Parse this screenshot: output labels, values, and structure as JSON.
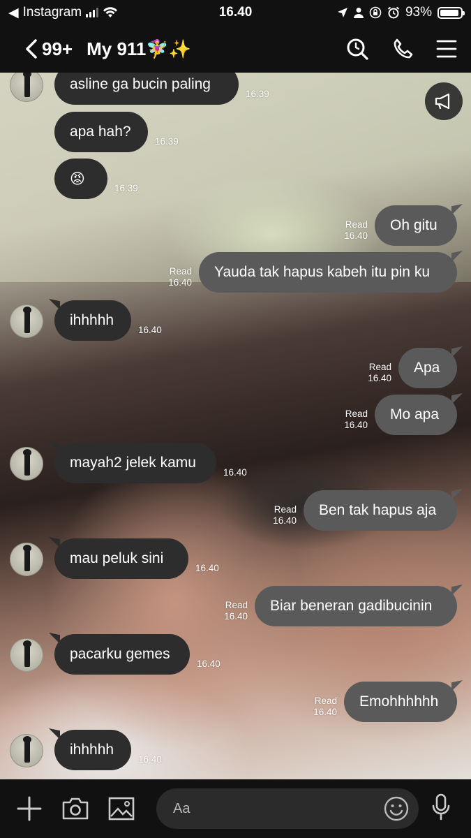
{
  "status_bar": {
    "back_app": "Instagram",
    "time": "16.40",
    "battery": "93%",
    "battery_level": 0.93
  },
  "header": {
    "back_count": "99+",
    "title": "My 911🧚‍♀️✨"
  },
  "input": {
    "placeholder": "Aa"
  },
  "messages": [
    {
      "side": "in",
      "text": "asline ga bucin paling",
      "time": "16.39"
    },
    {
      "side": "in",
      "text": "apa hah?",
      "time": "16.39"
    },
    {
      "side": "in",
      "text": "😡",
      "time": "16.39"
    },
    {
      "side": "out",
      "text": "Oh gitu",
      "read": "Read",
      "time": "16.40"
    },
    {
      "side": "out",
      "text": "Yauda tak hapus kabeh itu pin ku",
      "read": "Read",
      "time": "16.40"
    },
    {
      "side": "in",
      "text": "ihhhhh",
      "time": "16.40"
    },
    {
      "side": "out",
      "text": "Apa",
      "read": "Read",
      "time": "16.40"
    },
    {
      "side": "out",
      "text": "Mo apa",
      "read": "Read",
      "time": "16.40"
    },
    {
      "side": "in",
      "text": "mayah2 jelek kamu",
      "time": "16.40"
    },
    {
      "side": "out",
      "text": "Ben tak hapus aja",
      "read": "Read",
      "time": "16.40"
    },
    {
      "side": "in",
      "text": "mau peluk sini",
      "time": "16.40"
    },
    {
      "side": "out",
      "text": "Biar beneran gadibucinin",
      "read": "Read",
      "time": "16.40"
    },
    {
      "side": "in",
      "text": "pacarku gemes",
      "time": "16.40"
    },
    {
      "side": "out",
      "text": "Emohhhhhh",
      "read": "Read",
      "time": "16.40"
    },
    {
      "side": "in",
      "text": "ihhhhh",
      "time": "16.40"
    }
  ]
}
